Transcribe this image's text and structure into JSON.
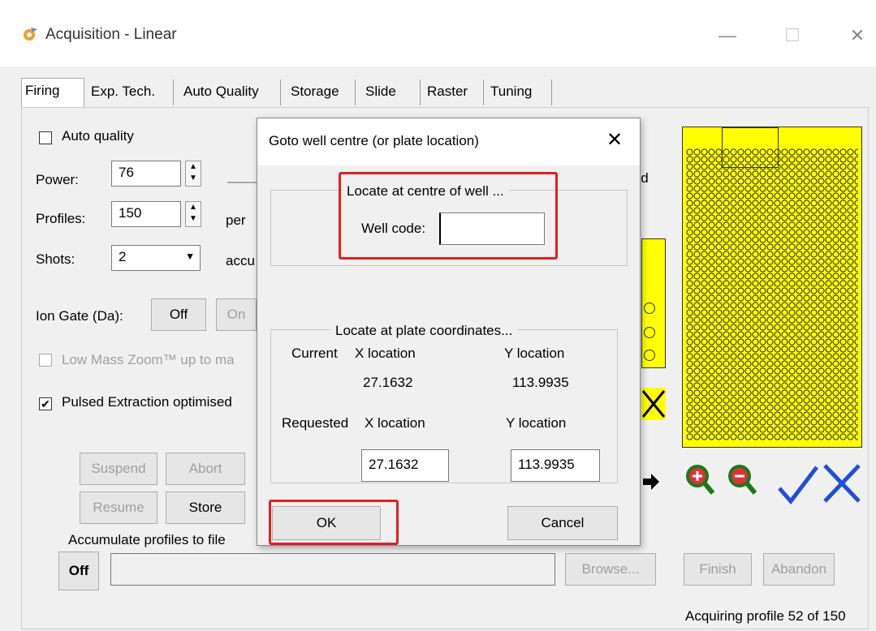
{
  "window": {
    "title": "Acquisition - Linear",
    "controls": {
      "minimize": "—",
      "maximize": "☐",
      "close": "✕"
    }
  },
  "tabs": [
    {
      "label": "Firing",
      "active": true
    },
    {
      "label": "Exp. Tech."
    },
    {
      "label": "Auto Quality"
    },
    {
      "label": "Storage"
    },
    {
      "label": "Slide"
    },
    {
      "label": "Raster"
    },
    {
      "label": "Tuning"
    }
  ],
  "firing": {
    "auto_quality_label": "Auto quality",
    "auto_quality_checked": false,
    "power_label": "Power:",
    "power_value": "76",
    "profiles_label": "Profiles:",
    "profiles_value": "150",
    "profiles_suffix": "per",
    "shots_label": "Shots:",
    "shots_value": "2",
    "shots_suffix": "accu",
    "hold_fragment": "old",
    "ion_gate_label": "Ion Gate (Da):",
    "ion_gate_off": "Off",
    "ion_gate_on": "On",
    "low_mass_label": "Low Mass Zoom™ up to ma",
    "pulsed_label": "Pulsed Extraction optimised",
    "pulsed_checked": true,
    "suspend": "Suspend",
    "abort": "Abort",
    "resume": "Resume",
    "store": "Store",
    "accumulate_label": "Accumulate profiles to file",
    "accumulate_off": "Off",
    "browse": "Browse...",
    "finish": "Finish",
    "abandon": "Abandon",
    "status": "Acquiring profile 52 of 150"
  },
  "dialog": {
    "title": "Goto well centre (or plate location)",
    "close": "✕",
    "well_group_label": "Locate at centre of well ...",
    "well_code_label": "Well code:",
    "well_code_value": "",
    "coords_group_label": "Locate at plate coordinates...",
    "current_label": "Current",
    "x_location_label": "X location",
    "y_location_label": "Y location",
    "current_x": "27.1632",
    "current_y": "113.9935",
    "requested_label": "Requested",
    "requested_x": "27.1632",
    "requested_y": "113.9935",
    "ok": "OK",
    "cancel": "Cancel"
  },
  "colors": {
    "plate": "#ffff00",
    "highlight": "#e02020",
    "zoom_icon": "#1a7a1a",
    "tick_icon": "#1f4fd6"
  }
}
